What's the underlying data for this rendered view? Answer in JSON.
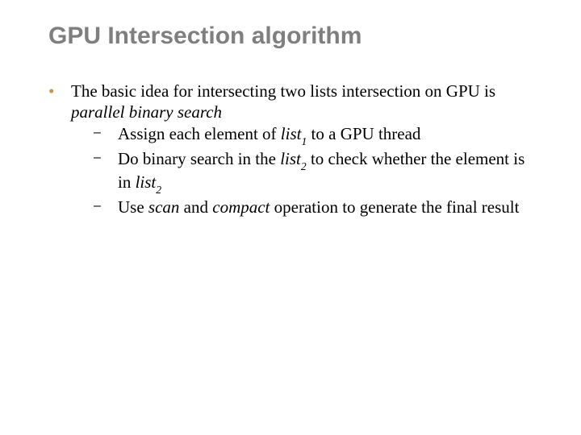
{
  "title": "GPU Intersection algorithm",
  "body": {
    "l1_pre": "The basic idea for intersecting two lists intersection on GPU is ",
    "l1_em": "parallel binary search",
    "sub1": {
      "pre": "Assign each element of ",
      "list": "list",
      "subn": "1",
      "post": " to a GPU thread"
    },
    "sub2": {
      "pre": "Do binary search in the ",
      "list": "list",
      "subn": "2",
      "mid": " to check whether the element is in ",
      "list2": "list",
      "subn2": "2"
    },
    "sub3": {
      "pre": "Use ",
      "scan": "scan",
      "and": " and ",
      "compact": "compact",
      "post": " operation to generate the final result"
    }
  }
}
